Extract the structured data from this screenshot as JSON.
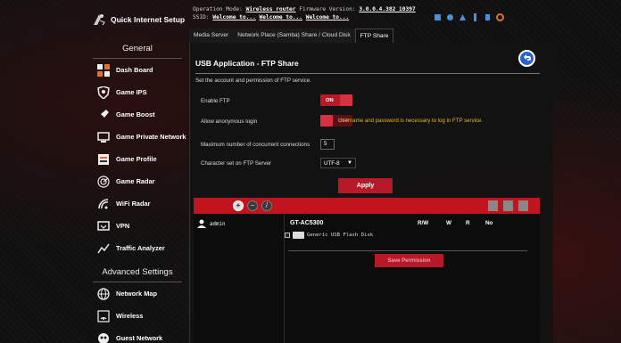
{
  "topbar": {
    "qis_label": "Quick Internet Setup",
    "op_mode_label": "Operation Mode:",
    "op_mode_value": "Wireless router",
    "fw_label": "Firmware Version:",
    "fw_value": "3.0.0.4.382_10397",
    "ssid_label": "SSID:",
    "ssid_values": [
      "Welcome to...",
      "Welcome to...",
      "Welcome to..."
    ]
  },
  "sidebar": {
    "general_title": "General",
    "items": [
      {
        "label": "Dash Board",
        "icon": "dashboard-icon"
      },
      {
        "label": "Game IPS",
        "icon": "shield-icon"
      },
      {
        "label": "Game Boost",
        "icon": "rocket-icon"
      },
      {
        "label": "Game Private Network",
        "icon": "monitor-icon"
      },
      {
        "label": "Game Profile",
        "icon": "profile-icon"
      },
      {
        "label": "Game Radar",
        "icon": "radar-icon"
      },
      {
        "label": "WiFi Radar",
        "icon": "wifi-radar-icon"
      },
      {
        "label": "VPN",
        "icon": "vpn-icon"
      },
      {
        "label": "Traffic Analyzer",
        "icon": "analyzer-icon"
      }
    ],
    "advanced_title": "Advanced Settings",
    "advanced_items": [
      {
        "label": "Network Map",
        "icon": "globe-icon"
      },
      {
        "label": "Wireless",
        "icon": "wireless-icon"
      },
      {
        "label": "Guest Network",
        "icon": "guest-icon"
      }
    ]
  },
  "tabs": [
    {
      "label": "Media Server",
      "active": false
    },
    {
      "label": "Network Place (Samba) Share / Cloud Disk",
      "active": false
    },
    {
      "label": "FTP Share",
      "active": true
    }
  ],
  "panel": {
    "title": "USB Application - FTP Share",
    "description": "Set the account and permission of FTP service.",
    "enable_ftp_label": "Enable FTP",
    "enable_ftp_state": "ON",
    "anon_label": "Allow anonymous login",
    "anon_state": "OFF",
    "anon_warning": "Username and password is necessary to log in FTP service.",
    "max_conn_label": "Maximum number of concurrent connections",
    "max_conn_value": "5",
    "charset_label": "Character set on FTP Server",
    "charset_value": "UTF-8",
    "apply_label": "Apply"
  },
  "share": {
    "user": "admin",
    "device": "GT-AC5300",
    "perm_headers": [
      "R/W",
      "W",
      "R",
      "No"
    ],
    "disk_label": "Generic USB Flash Disk",
    "save_label": "Save Permission"
  },
  "colors": {
    "accent": "#b81928",
    "warning": "#e8b628",
    "back_button": "#2a64c8"
  }
}
